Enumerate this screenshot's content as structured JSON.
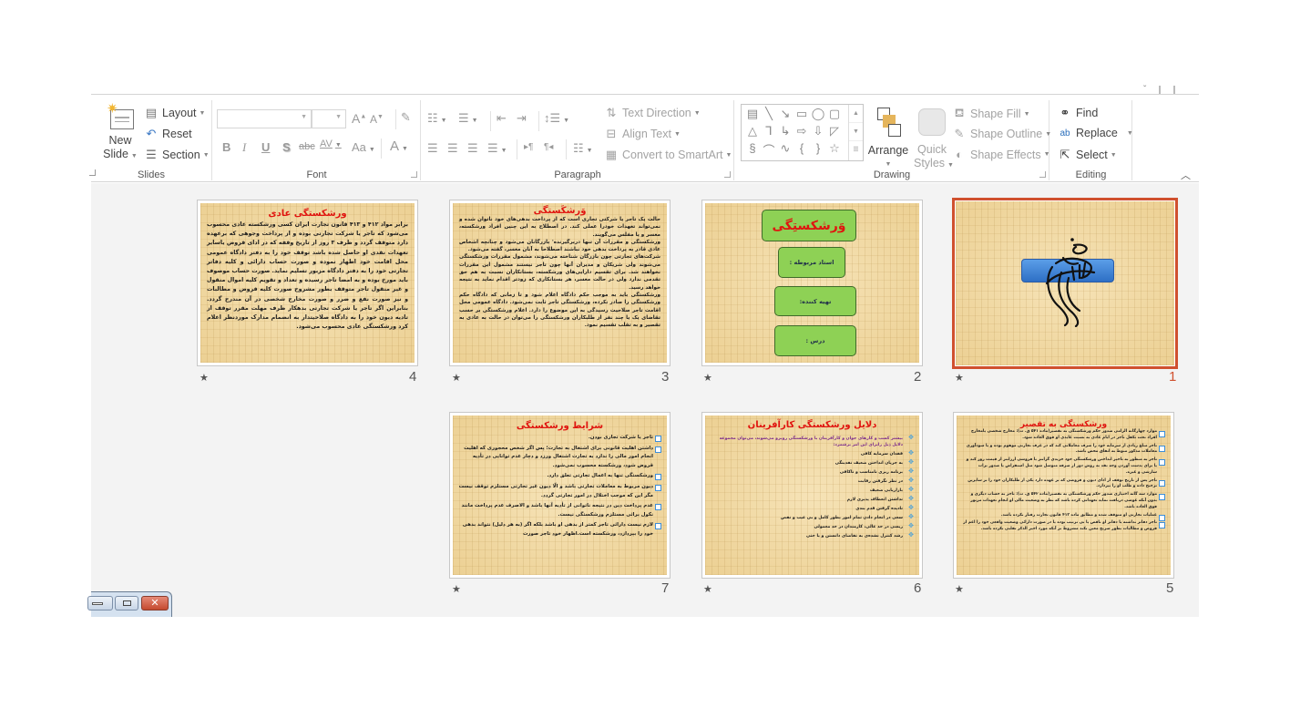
{
  "ribbon": {
    "slides_group": {
      "label": "Slides",
      "new_slide": "New",
      "new_slide_2": "Slide",
      "layout": "Layout",
      "reset": "Reset",
      "section": "Section"
    },
    "font_group": {
      "label": "Font",
      "font_name": "",
      "font_size": "",
      "bold": "B",
      "italic": "I",
      "underline": "U",
      "shadow": "S",
      "strikethrough": "abc",
      "char_spacing": "AV",
      "change_case": "Aa",
      "font_color": "A",
      "grow": "A",
      "shrink": "A"
    },
    "paragraph_group": {
      "label": "Paragraph",
      "text_direction": "Text Direction",
      "align_text": "Align Text",
      "convert_smartart": "Convert to SmartArt"
    },
    "drawing_group": {
      "label": "Drawing",
      "arrange": "Arrange",
      "quick_styles_1": "Quick",
      "quick_styles_2": "Styles",
      "shape_fill": "Shape Fill",
      "shape_outline": "Shape Outline",
      "shape_effects": "Shape Effects",
      "shapes": [
        "▤",
        "╲",
        "↘",
        "▭",
        "◯",
        "▢",
        "△",
        "⅂",
        "↳",
        "⇨",
        "⇩",
        "◸",
        "§",
        "⌒",
        "∿",
        "{",
        "}",
        "☆"
      ]
    },
    "editing_group": {
      "label": "Editing",
      "find": "Find",
      "replace": "Replace",
      "select": "Select"
    }
  },
  "slides": [
    {
      "number": "1",
      "selected": true,
      "star": "★",
      "type": "title-calligraphy"
    },
    {
      "number": "2",
      "star": "★",
      "title": "وَرشکستِگی",
      "boxes": [
        "استاد مربوطه :",
        "تهیه کننده:",
        "درس :"
      ]
    },
    {
      "number": "3",
      "star": "★",
      "title": "وَرشکَستگی",
      "paragraphs": [
        "حالت یک تاجر یا شرکتی تجاری است که از پرداخت بدهی‌های خود ناتوان شده و نمی‌تواند تعهدات خودرا عملی کند. در اصطلاح به این چنین افراد ورشکسته، معسر و یا مفلس می‌گویند.",
        "ورشکستگی و مقررات آن تنها دربرگیرنده' بازرگانان می‌شود و چنانچه اشخاص عادی قادر به پرداخت بدهی خود نباشند اصطلاحا به آنان معسر، گفته می‌شود.",
        "شرکت‌های تجارتی چون بازرگان شناخته می‌شوند، مشمول مقررات ورشکستگی می‌شوند ولی شریکان و مدیران آنها چون تاجر نیستند مشمول این مقررات نخواهند شد. برای تقسیم دارایی‌های ورشکسته، بستانکاران نسبت به هم حق تقدمی ندارد ولی در حالت معسر، هر بستانکاری که زودتر اقدام نماید به نتیجه خواهد رسید.",
        "ورشکستگی باید به موجب حکم دادگاه اعلام شود و تا زمانی که دادگاه حکم ورشکستگی را صادر نکرده، ورشکستگی تاجر ثابت نمی‌شود. دادگاه عمومی محل اقامت تاجر صلاحیت رسیدگی به این موضوع را دارد. اعلام ورشکستگی بر حسب تقاضای یک یا چند نفر از طلبکاران ورشکستگی را می‌توان در حالت به عادی به تقصیر و به تقلب تقسیم نمود."
      ]
    },
    {
      "number": "4",
      "star": "★",
      "title": "ورشکستگی عادی",
      "paragraphs": [
        "برابر مواد ۴۱۲ و ۴۱۳ قانون تجارت ایران کسی ورشکسته عادی محسوب می‌شود که تاجر یا شرکت تجارتی بوده و از پرداخت وجوهی که برعهده دارد متوقف گردد و ظرف ۳ روز از تاریخ وقفه که در ادای قروض یاسایر تعهدات نقدی او حاصل شده باشد توقف خود را به دفتر دادگاه عمومی محل اقامت خود اظهار نموده و صورت حساب دارائی و کلیه دفاتر تجارتی خود را به دفتر دادگاه مزبور تسلیم نماید. صورت حساب موصوف باید مورخ بوده و به امضا تاجر رسیده و تعداد و تقویم کلیه اموال منقول و غیر منقول تاجر متوقف بطور مشروح صورت کلیه قروض و مطالبات و نیز صورت نفع و ضرر و صورت مخارج شخصی در آن مندرج گردد. بنابراین اگر تاجر یا شرکت تجارتی بدهکار ظرف مهلت مقرر توقف از تادیه دیون خود را به دادگاه صلاحیتدار به انضمام مدارک موردنظر اعلام کرد ورشکستگی عادی محسوب می‌شود."
      ]
    },
    {
      "number": "5",
      "star": "★",
      "title": "ورشکستگی به تقصیر",
      "items": [
        "موارد چهارگانه الزامی صدور حکم ورشکستگی به تقصیر(ماده ۵۴۱ ق. ت): مخارج شخصی یامخارج افراد تحت تکفل تاجر در ایام عادی به نسبت عایدی او فوق العاده شود.",
        "تاجر مبلغ زیادی از سرمایه خود را صرف معاملاتی کند که در عرف تجارتی موهوم بوده و یا سودآوری معاملات مذکور منوط به اتفاق محض باشد.",
        "تاجر به منظور به تاخیر انداختن ورشکستگی خود خریدی گرانتر یا فروشی ارزانتر از قیمت روز کند و یا برای بدست آوردن وجه نقد به روش دور از صرفه متوسل شود مثل استقراض یا صدور برات سازشی و غیره.",
        "تاجر پس از تاریخ توقف از ادای دیون و قروضی که بر عهده دارد یکی از طلبکاران خود را بر سایرین ترجیح داده و طلب او را بپردازد.",
        "موارد سه گانه اختیاری صدور حکم ورشکستگی به تقصیر(ماده ۵۴۲ ق. ت): تاجر به حساب دیگری و بدون آنکه عوضی دریافت نماید تعهداتی کرده باشد که نظر به وضعیت مالی او انجام تعهدات مزبور فوق العاده باشد.",
        "عملیات تجارتی او متوقف شده و مطابق ماده ۴۱۳ قانون تجارت رفتار نکرده باشد.",
        "تاجر دفاتر نداشته یا دفاتر او ناقص یا بی ترتیب بوده یا در صورت دارائی وضعیت واقعی خود را اعم از قروض و مطالبات بطور صریح معین نکند مشروط بر آنکه مورد اخیر الذکر تقلبی نکرده باشد."
      ]
    },
    {
      "number": "6",
      "star": "★",
      "title": "دلایل ورشکستگی کارآفرینان",
      "items": [
        "بیشتر کسب و کارهای جوان و کارآفرینان با ورشکستگی روبرو می‌شوند، می‌توان مجموعه دلایل ذیل رابرای این امر برشمرد:",
        "فقدان سرمایه کافی",
        "به جریان انداختن ضعیف نقدینگی",
        "برنامه ریزی نامناسب و ناکافی",
        "در نظر نگرفتن رقابت",
        "بازاریابی ضعیف",
        "نداشتن انعطاف پذیری لازم",
        "نادیده گرفتن قدم بندی",
        "سعی در انجام دادن تمام امور بطور کامل و بی عیب و نقص",
        "ریسی در حد عالی، کارمندان در حد معمولی",
        "رشد کنترل نشده‌ی به تقاضای دانستن و یا حتی"
      ]
    },
    {
      "number": "7",
      "star": "★",
      "title": "شرایط ورشکستگی",
      "items": [
        "تاجر یا شرکت تجاری بودن.",
        "داشتن اهلیت قانونی برای اشتغال به تجارت؛ پس اگر شخص محجوری که اهلیت انجام امور مالی را ندارد به تجارت اشتغال ورزد و دچار عدم توانایی در تأدیه قروض شود، ورشکسته محسوب نمی‌شود.",
        "ورشکستگی تنها به اعمال تجارتی تعلق دارد.",
        "دیون مربوط به معاملات تجارتی باشد و الّا دیون غیر تجارتی مستلزم توقف نیست مگر این که موجب اختلال در امور تجارتی گردد.",
        "عدم پرداخت دین در نتیجه ناتوانی از تأدیه آنها باشد و الاصرف عدم پرداخت مانند نکول برائی مستلزم ورشکستگی نیست.",
        "لازم نیست دارائی تاجر کمتر از بدهی او باشد بلکه اگر (به هر دلیل) نتواند بدهی خود را بپردازد، ورشکسته است.اظهار خود تاجر صورت"
      ]
    }
  ],
  "colors": {
    "selection": "#d0502e",
    "slide_title": "#e0140f",
    "green_box": "#8ed155",
    "blue_bar": "#2e6fc5"
  }
}
